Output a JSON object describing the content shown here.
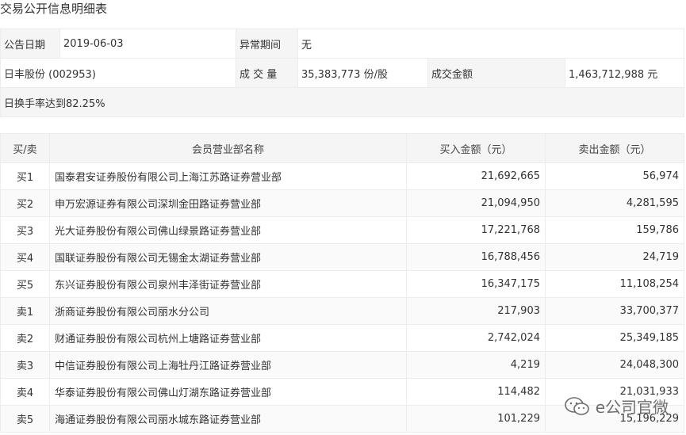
{
  "title": "交易公开信息明细表",
  "info": {
    "announce_date_label": "公告日期",
    "announce_date": "2019-06-03",
    "abnormal_period_label": "异常期间",
    "abnormal_period": "无",
    "stock_name": "日丰股份 (002953)",
    "volume_label": "成 交 量",
    "volume": "35,383,773 份/股",
    "amount_label": "成交金额",
    "amount": "1,463,712,988 元",
    "note": "日换手率达到82.25%"
  },
  "table": {
    "headers": [
      "买/卖",
      "会员营业部名称",
      "买入金额（元）",
      "卖出金额（元）"
    ],
    "rows": [
      {
        "side": "买1",
        "name": "国泰君安证券股份有限公司上海江苏路证券营业部",
        "buy": "21,692,665",
        "sell": "56,974"
      },
      {
        "side": "买2",
        "name": "申万宏源证券有限公司深圳金田路证券营业部",
        "buy": "21,094,950",
        "sell": "4,281,595"
      },
      {
        "side": "买3",
        "name": "光大证券股份有限公司佛山绿景路证券营业部",
        "buy": "17,221,768",
        "sell": "159,786"
      },
      {
        "side": "买4",
        "name": "国联证券股份有限公司无锡金太湖证券营业部",
        "buy": "16,788,456",
        "sell": "24,719"
      },
      {
        "side": "买5",
        "name": "东兴证券股份有限公司泉州丰泽街证券营业部",
        "buy": "16,347,175",
        "sell": "11,108,254"
      },
      {
        "side": "卖1",
        "name": "浙商证券股份有限公司丽水分公司",
        "buy": "217,903",
        "sell": "33,700,377"
      },
      {
        "side": "卖2",
        "name": "财通证券股份有限公司杭州上塘路证券营业部",
        "buy": "2,742,024",
        "sell": "25,349,185"
      },
      {
        "side": "卖3",
        "name": "中信证券股份有限公司上海牡丹江路证券营业部",
        "buy": "4,219",
        "sell": "24,048,300"
      },
      {
        "side": "卖4",
        "name": "华泰证券股份有限公司佛山灯湖东路证券营业部",
        "buy": "114,482",
        "sell": "21,031,933"
      },
      {
        "side": "卖5",
        "name": "海通证券股份有限公司丽水城东路证券营业部",
        "buy": "101,229",
        "sell": "15,196,229"
      }
    ]
  },
  "watermark": {
    "text": "e公司官微",
    "icon": "wechat-icon"
  }
}
